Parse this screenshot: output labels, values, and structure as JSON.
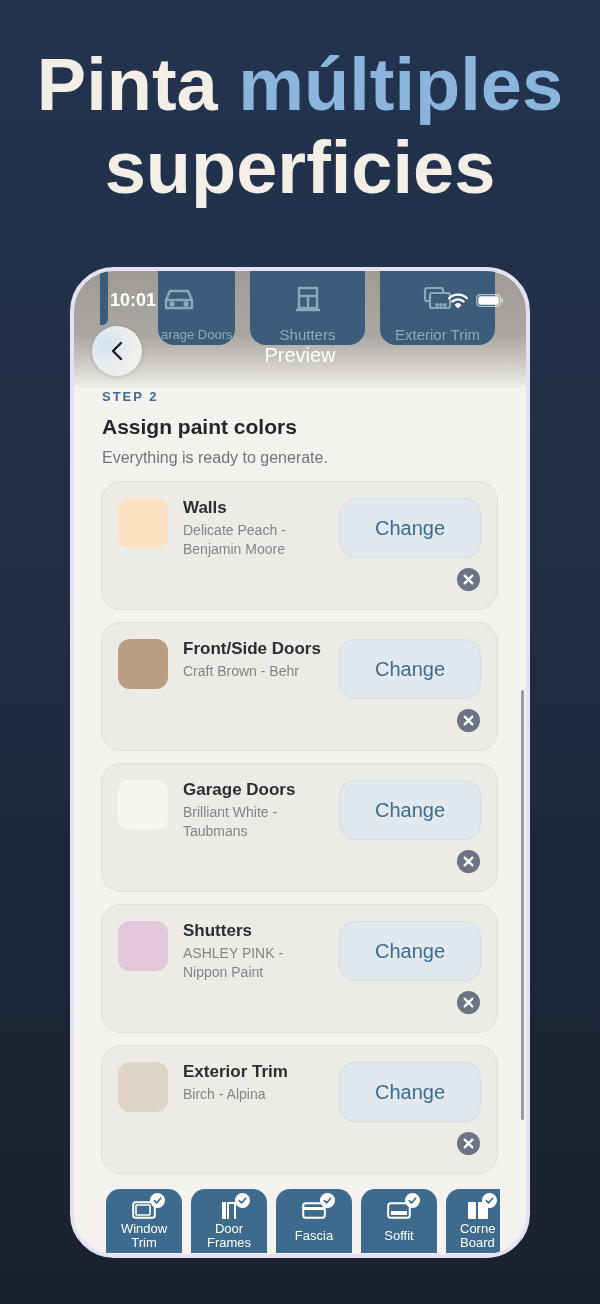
{
  "headline": [
    {
      "text": "Pinta",
      "highlight": false
    },
    {
      "text": "múltiples",
      "highlight": true
    },
    {
      "text": "superficies",
      "highlight": false
    }
  ],
  "status_bar": {
    "time": "10:01"
  },
  "nav": {
    "title": "Preview"
  },
  "header_tiles": [
    {
      "label": "arage Doors"
    },
    {
      "label": "Shutters"
    },
    {
      "label": "Exterior Trim"
    }
  ],
  "step": {
    "label": "STEP 2",
    "title": "Assign paint colors",
    "subtitle": "Everything is ready to generate."
  },
  "surfaces": [
    {
      "name": "Walls",
      "paint": "Delicate Peach - Benjamin Moore",
      "color": "#fde2c3",
      "action": "Change"
    },
    {
      "name": "Front/Side Doors",
      "paint": "Craft Brown - Behr",
      "color": "#b89d80",
      "action": "Change"
    },
    {
      "name": "Garage Doors",
      "paint": "Brilliant White - Taubmans",
      "color": "#f6f5ef",
      "action": "Change"
    },
    {
      "name": "Shutters",
      "paint": "ASHLEY PINK - Nippon Paint",
      "color": "#e3c7da",
      "action": "Change"
    },
    {
      "name": "Exterior Trim",
      "paint": "Birch - Alpina",
      "color": "#ded4c6",
      "action": "Change"
    }
  ],
  "bottom_tiles": [
    {
      "label": "Window Trim",
      "checked": true
    },
    {
      "label": "Door Frames",
      "checked": true
    },
    {
      "label": "Fascia",
      "checked": true
    },
    {
      "label": "Soffit",
      "checked": true
    },
    {
      "label": "Corne Board",
      "checked": true
    }
  ]
}
